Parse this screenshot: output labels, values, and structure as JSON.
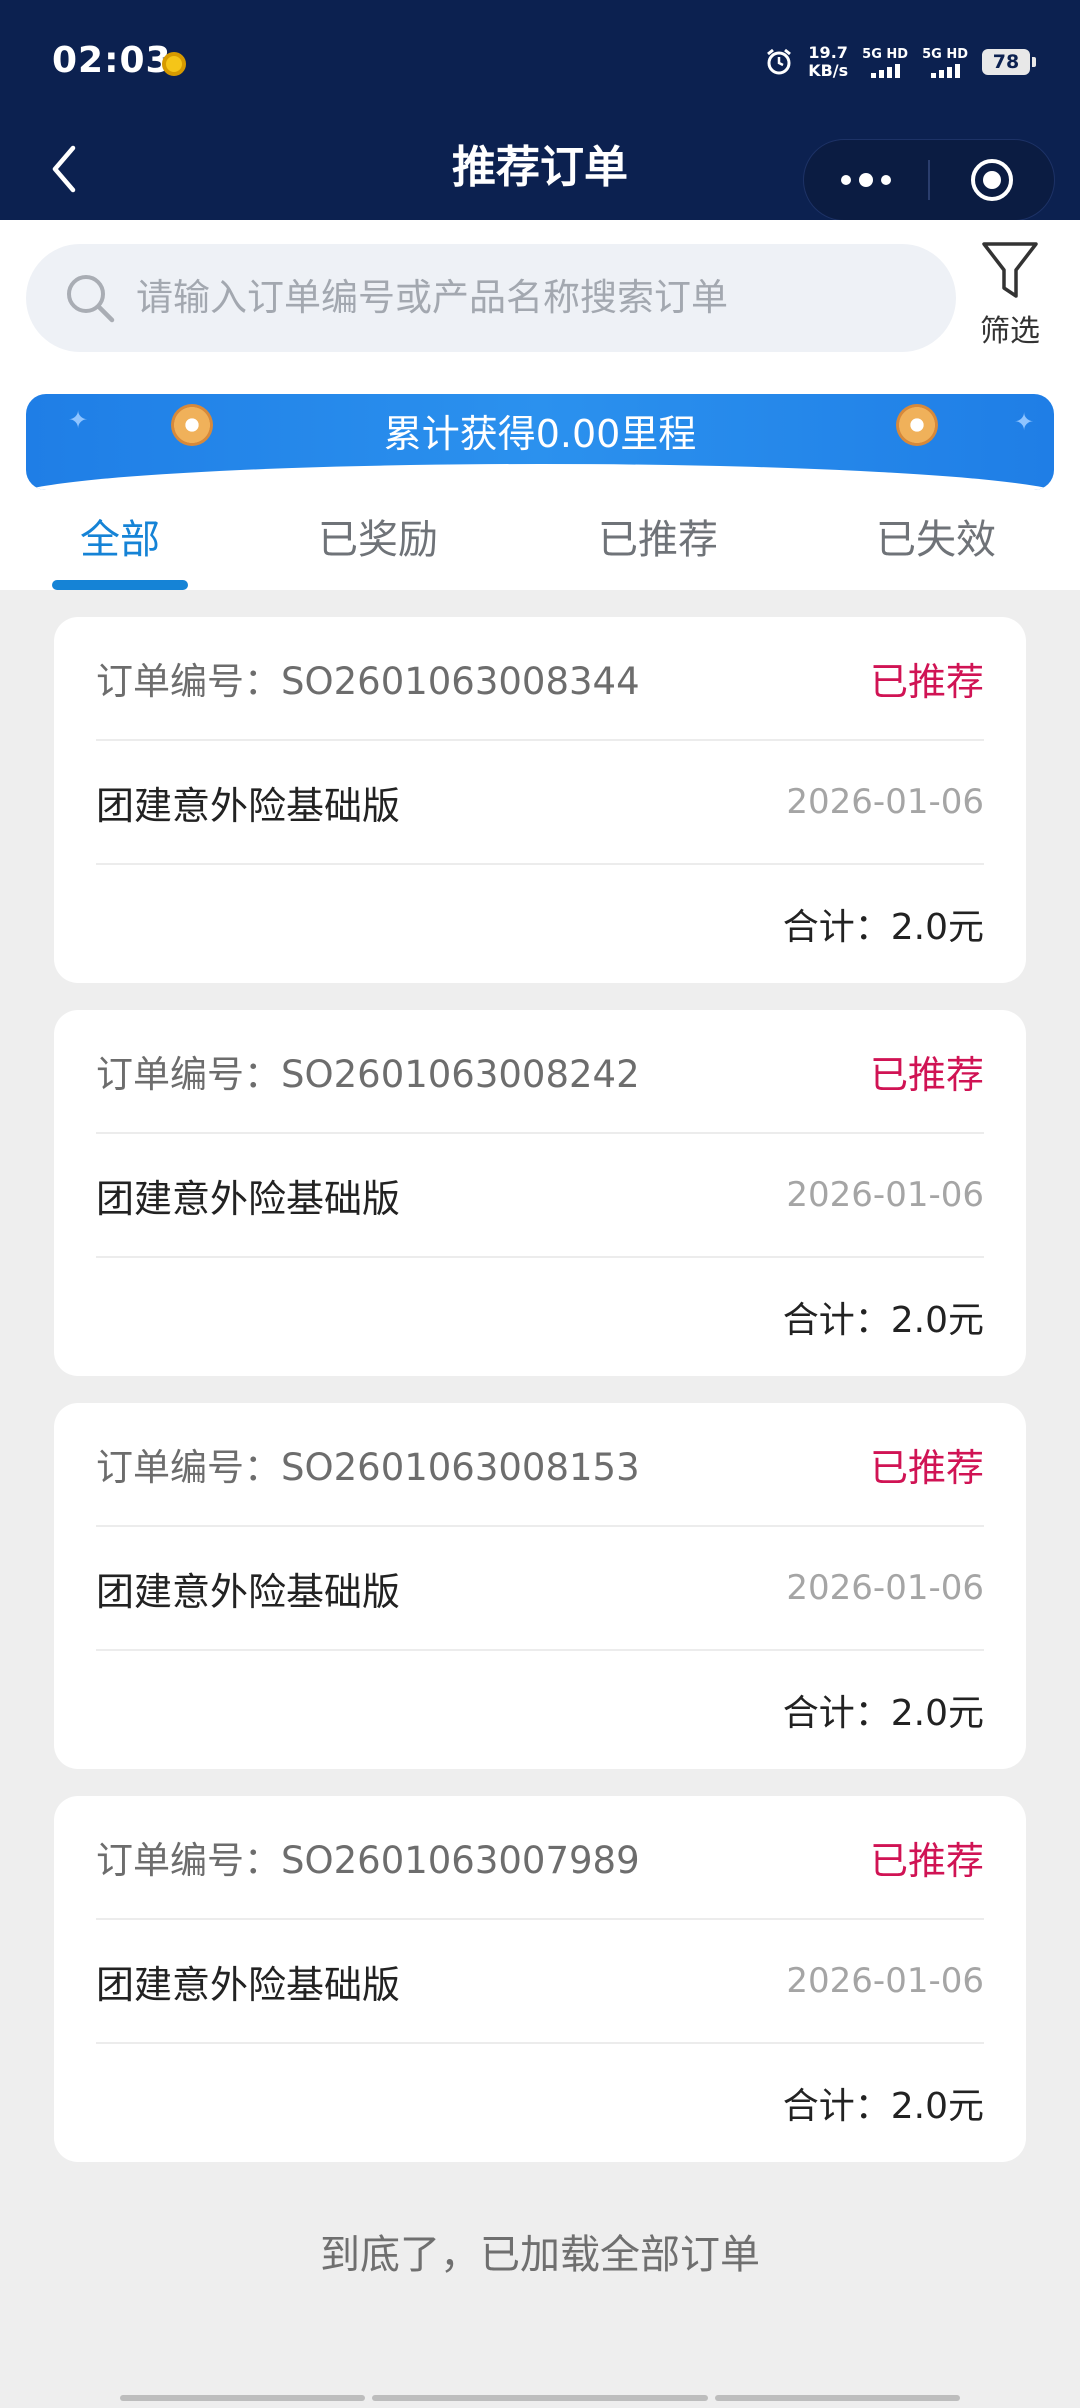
{
  "status_bar": {
    "time": "02:03",
    "net_speed_value": "19.7",
    "net_speed_unit": "KB/s",
    "sim1_label": "5G HD",
    "sim2_label": "5G HD",
    "battery": "78"
  },
  "nav": {
    "title": "推荐订单"
  },
  "search": {
    "placeholder": "请输入订单编号或产品名称搜索订单",
    "filter_label": "筛选"
  },
  "banner": {
    "text": "累计获得0.00里程"
  },
  "tabs": [
    {
      "label": "全部",
      "active": true
    },
    {
      "label": "已奖励",
      "active": false
    },
    {
      "label": "已推荐",
      "active": false
    },
    {
      "label": "已失效",
      "active": false
    }
  ],
  "orders": [
    {
      "order_no": "订单编号：SO2601063008344",
      "status": "已推荐",
      "product": "团建意外险基础版",
      "date": "2026-01-06",
      "total": "合计：2.0元"
    },
    {
      "order_no": "订单编号：SO2601063008242",
      "status": "已推荐",
      "product": "团建意外险基础版",
      "date": "2026-01-06",
      "total": "合计：2.0元"
    },
    {
      "order_no": "订单编号：SO2601063008153",
      "status": "已推荐",
      "product": "团建意外险基础版",
      "date": "2026-01-06",
      "total": "合计：2.0元"
    },
    {
      "order_no": "订单编号：SO2601063007989",
      "status": "已推荐",
      "product": "团建意外险基础版",
      "date": "2026-01-06",
      "total": "合计：2.0元"
    }
  ],
  "footer": {
    "text": "到底了，已加载全部订单"
  },
  "colors": {
    "header_bg": "#0c2150",
    "accent": "#1583d6",
    "status_red": "#d01354",
    "banner_blue": "#2b91ee"
  },
  "icons": [
    "alarm-icon",
    "back-arrow-icon",
    "more-dots-icon",
    "target-circle-icon",
    "search-icon",
    "filter-funnel-icon",
    "coin-icon",
    "sparkle-icon"
  ]
}
